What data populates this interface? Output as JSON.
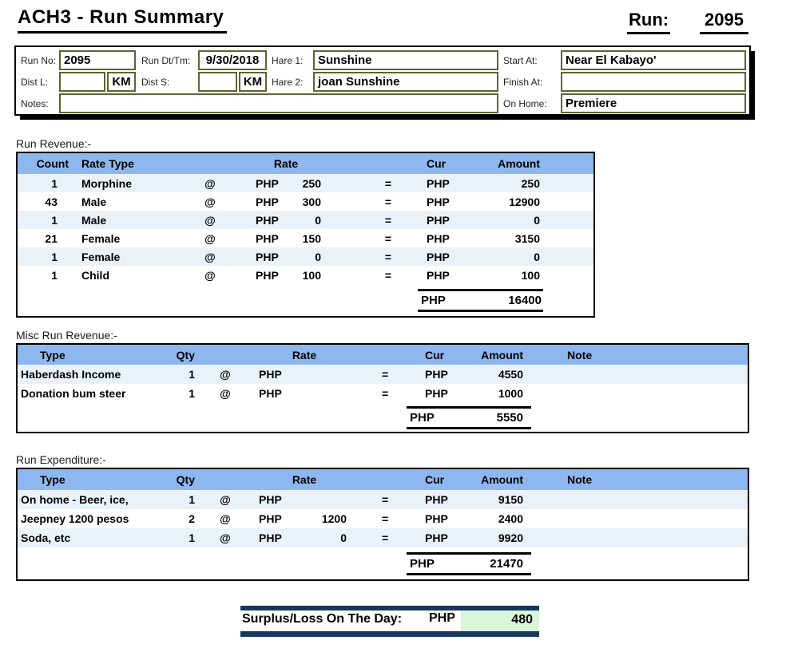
{
  "header": {
    "title": "ACH3 - Run Summary",
    "run_label": "Run:",
    "run_value": "2095"
  },
  "form": {
    "run_no": {
      "label": "Run No:",
      "value": "2095"
    },
    "run_dt": {
      "label": "Run Dt/Tm:",
      "value": "9/30/2018"
    },
    "hare1": {
      "label": "Hare 1:",
      "value": "Sunshine"
    },
    "start_at": {
      "label": "Start At:",
      "value": "Near El Kabayo'"
    },
    "dist_l": {
      "label": "Dist L:",
      "value": "",
      "unit": "KM"
    },
    "dist_s": {
      "label": "Dist S:",
      "value": "",
      "unit": "KM"
    },
    "hare2": {
      "label": "Hare 2:",
      "value": "joan Sunshine"
    },
    "finish_at": {
      "label": "Finish At:",
      "value": ""
    },
    "notes": {
      "label": "Notes:",
      "value": ""
    },
    "on_home": {
      "label": "On Home:",
      "value": "Premiere"
    }
  },
  "revenue": {
    "section_label": "Run Revenue:-",
    "headers": {
      "count": "Count",
      "rate_type": "Rate Type",
      "rate": "Rate",
      "cur": "Cur",
      "amount": "Amount"
    },
    "rows": [
      {
        "count": "1",
        "type": "Morphine",
        "at": "@",
        "rate_cur": "PHP",
        "rate": "250",
        "eq": "=",
        "cur": "PHP",
        "amount": "250"
      },
      {
        "count": "43",
        "type": "Male",
        "at": "@",
        "rate_cur": "PHP",
        "rate": "300",
        "eq": "=",
        "cur": "PHP",
        "amount": "12900"
      },
      {
        "count": "1",
        "type": "Male",
        "at": "@",
        "rate_cur": "PHP",
        "rate": "0",
        "eq": "=",
        "cur": "PHP",
        "amount": "0"
      },
      {
        "count": "21",
        "type": "Female",
        "at": "@",
        "rate_cur": "PHP",
        "rate": "150",
        "eq": "=",
        "cur": "PHP",
        "amount": "3150"
      },
      {
        "count": "1",
        "type": "Female",
        "at": "@",
        "rate_cur": "PHP",
        "rate": "0",
        "eq": "=",
        "cur": "PHP",
        "amount": "0"
      },
      {
        "count": "1",
        "type": "Child",
        "at": "@",
        "rate_cur": "PHP",
        "rate": "100",
        "eq": "=",
        "cur": "PHP",
        "amount": "100"
      }
    ],
    "total": {
      "cur": "PHP",
      "amount": "16400"
    }
  },
  "misc_revenue": {
    "section_label": "Misc Run Revenue:-",
    "headers": {
      "type": "Type",
      "qty": "Qty",
      "rate": "Rate",
      "cur": "Cur",
      "amount": "Amount",
      "note": "Note"
    },
    "rows": [
      {
        "type": "Haberdash Income",
        "qty": "1",
        "at": "@",
        "rate_cur": "PHP",
        "rate": "",
        "eq": "=",
        "cur": "PHP",
        "amount": "4550",
        "note": ""
      },
      {
        "type": "Donation bum steer",
        "qty": "1",
        "at": "@",
        "rate_cur": "PHP",
        "rate": "",
        "eq": "=",
        "cur": "PHP",
        "amount": "1000",
        "note": ""
      }
    ],
    "total": {
      "cur": "PHP",
      "amount": "5550"
    }
  },
  "expenditure": {
    "section_label": "Run Expenditure:-",
    "headers": {
      "type": "Type",
      "qty": "Qty",
      "rate": "Rate",
      "cur": "Cur",
      "amount": "Amount",
      "note": "Note"
    },
    "rows": [
      {
        "type": "On home - Beer, ice,",
        "qty": "1",
        "at": "@",
        "rate_cur": "PHP",
        "rate": "",
        "eq": "=",
        "cur": "PHP",
        "amount": "9150",
        "note": ""
      },
      {
        "type": "Jeepney 1200 pesos",
        "qty": "2",
        "at": "@",
        "rate_cur": "PHP",
        "rate": "1200",
        "eq": "=",
        "cur": "PHP",
        "amount": "2400",
        "note": ""
      },
      {
        "type": "Soda, etc",
        "qty": "1",
        "at": "@",
        "rate_cur": "PHP",
        "rate": "0",
        "eq": "=",
        "cur": "PHP",
        "amount": "9920",
        "note": ""
      }
    ],
    "total": {
      "cur": "PHP",
      "amount": "21470"
    }
  },
  "summary": {
    "label": "Surplus/Loss On The Day:",
    "cur": "PHP",
    "amount": "480"
  },
  "colors": {
    "header_blue": "#8DB7EE",
    "row_alt": "#EAF2F9",
    "navy_bar": "#17375D",
    "surplus_green": "#D9F6D9",
    "field_border_olive": "#5F6430"
  }
}
